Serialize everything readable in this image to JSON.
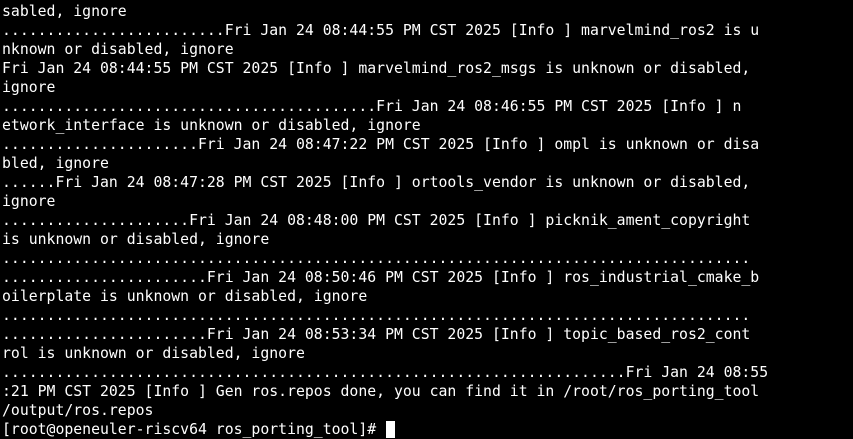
{
  "terminal": {
    "lines": [
      "sabled, ignore",
      ".........................Fri Jan 24 08:44:55 PM CST 2025 [Info ] marvelmind_ros2 is u",
      "nknown or disabled, ignore",
      "Fri Jan 24 08:44:55 PM CST 2025 [Info ] marvelmind_ros2_msgs is unknown or disabled,",
      "ignore",
      "..........................................Fri Jan 24 08:46:55 PM CST 2025 [Info ] n",
      "etwork_interface is unknown or disabled, ignore",
      "......................Fri Jan 24 08:47:22 PM CST 2025 [Info ] ompl is unknown or disa",
      "bled, ignore",
      "......Fri Jan 24 08:47:28 PM CST 2025 [Info ] ortools_vendor is unknown or disabled,",
      "ignore",
      ".....................Fri Jan 24 08:48:00 PM CST 2025 [Info ] picknik_ament_copyright",
      "is unknown or disabled, ignore",
      "....................................................................................",
      ".......................Fri Jan 24 08:50:46 PM CST 2025 [Info ] ros_industrial_cmake_b",
      "oilerplate is unknown or disabled, ignore",
      "....................................................................................",
      ".......................Fri Jan 24 08:53:34 PM CST 2025 [Info ] topic_based_ros2_cont",
      "rol is unknown or disabled, ignore",
      "......................................................................Fri Jan 24 08:55",
      ":21 PM CST 2025 [Info ] Gen ros.repos done, you can find it in /root/ros_porting_tool",
      "/output/ros.repos"
    ],
    "prompt": "[root@openeuler-riscv64 ros_porting_tool]# ",
    "colors": {
      "background": "#000000",
      "foreground": "#ffffff",
      "cursor": "#ffffff"
    }
  }
}
